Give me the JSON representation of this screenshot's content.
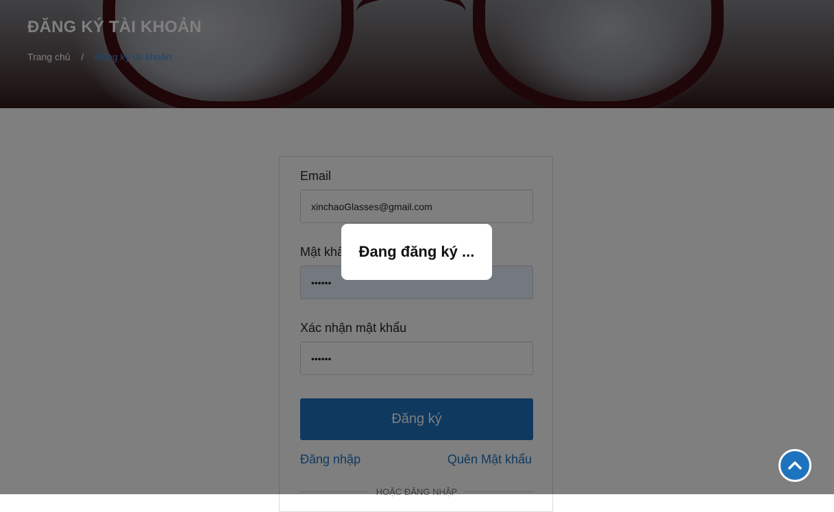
{
  "header": {
    "title": "ĐĂNG KÝ TÀI KHOẢN",
    "breadcrumb": {
      "home": "Trang chủ",
      "separator": "/",
      "current": "Đăng ký tài khoản"
    }
  },
  "form": {
    "email": {
      "label": "Email",
      "value": "xinchaoGlasses@gmail.com"
    },
    "password": {
      "label": "Mật khẩu",
      "value": "••••••"
    },
    "confirm_password": {
      "label": "Xác nhận mật khẩu",
      "value": "••••••"
    },
    "submit_label": "Đăng ký",
    "login_link": "Đăng nhập",
    "forgot_link": "Quên Mật khẩu",
    "divider_text": "HOẶC ĐĂNG NHẬP"
  },
  "overlay": {
    "message": "Đang đăng ký ..."
  },
  "back_to_top": {
    "icon": "chevron-up-icon"
  },
  "colors": {
    "accent": "#1e73be",
    "breadcrumb_current": "#3a8fe0",
    "overlay": "rgba(0,0,0,0.5)"
  }
}
